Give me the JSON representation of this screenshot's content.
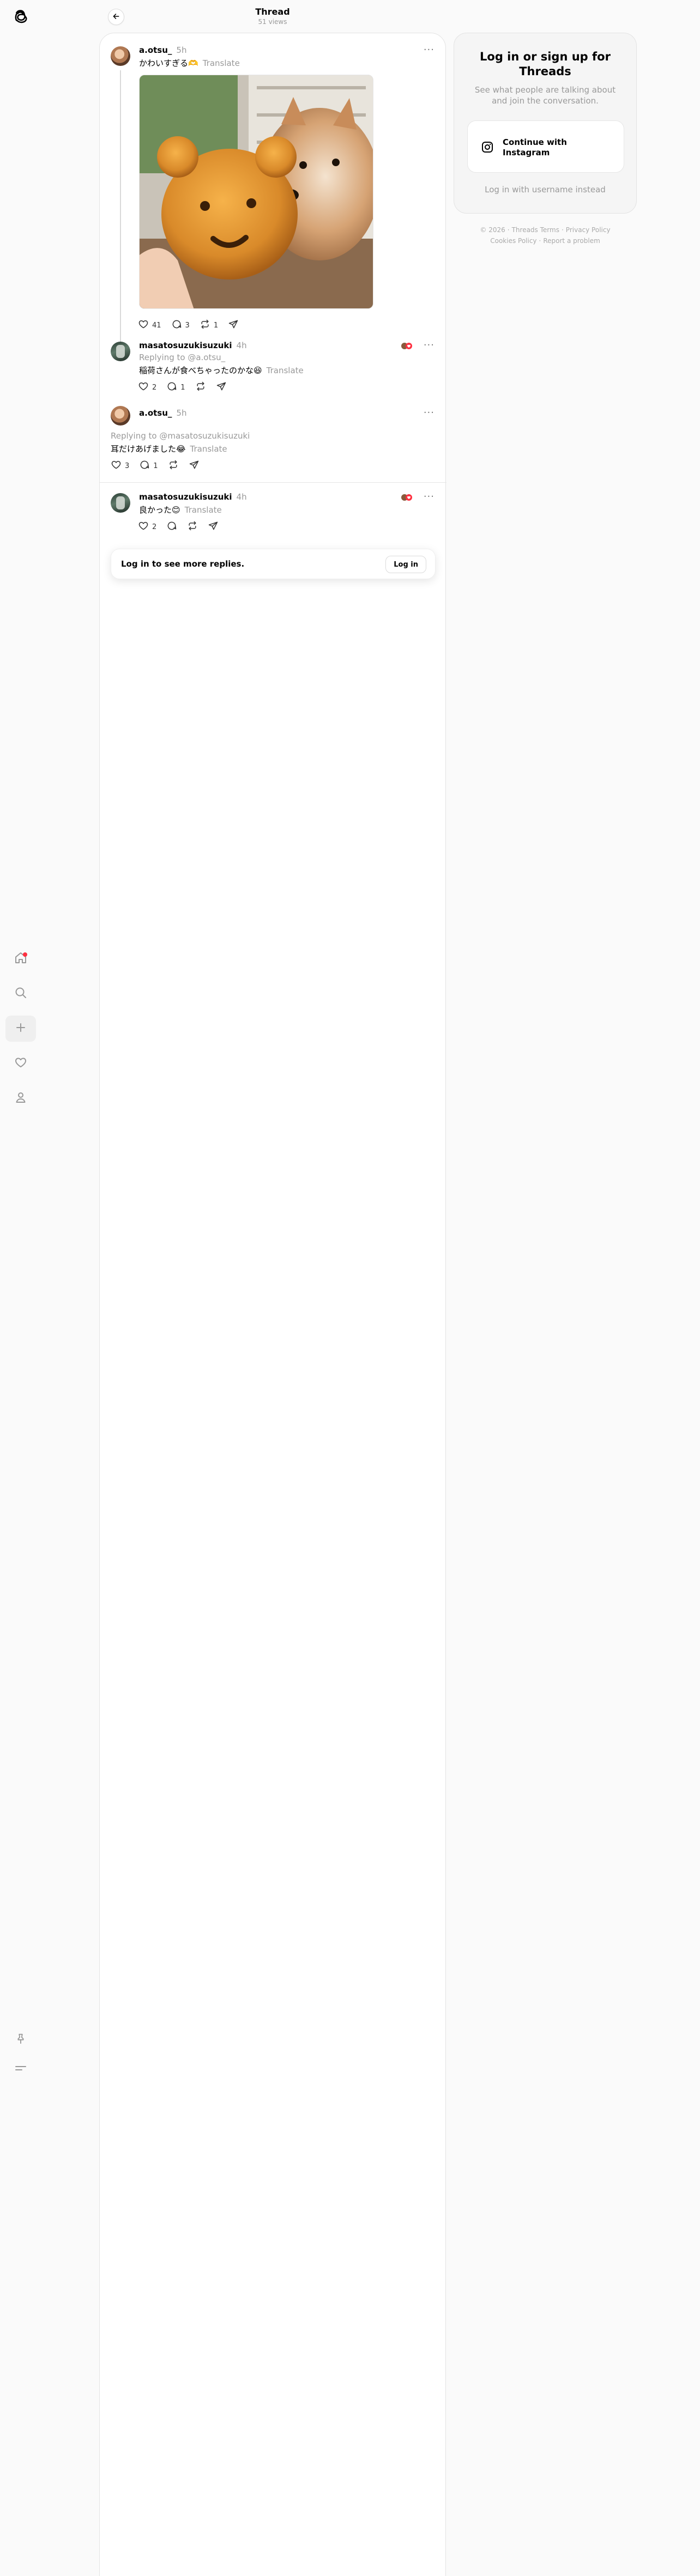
{
  "header": {
    "title": "Thread",
    "views": "51 views"
  },
  "posts": [
    {
      "username": "a.otsu_",
      "time": "5h",
      "text": "かわいすぎる🫶",
      "translate": "Translate",
      "image_alt": "bear-shaped bread held up next to a shiba inu dog",
      "likes": "41",
      "replies": "3",
      "reposts": "1"
    },
    {
      "username": "masatosuzukisuzuki",
      "time": "4h",
      "reply_to": "Replying to @a.otsu_",
      "text": "稲荷さんが食べちゃったのかな😆",
      "translate": "Translate",
      "likes": "2",
      "replies": "1"
    },
    {
      "username": "a.otsu_",
      "time": "5h",
      "reply_to": "Replying to @masatosuzukisuzuki",
      "text": "耳だけあげました😂",
      "translate": "Translate",
      "likes": "3",
      "replies": "1"
    },
    {
      "username": "masatosuzukisuzuki",
      "time": "4h",
      "text": "良かった😊",
      "translate": "Translate",
      "likes": "2"
    }
  ],
  "more_replies": {
    "text": "Log in to see more replies.",
    "button": "Log in"
  },
  "side_panel": {
    "title": "Log in or sign up for Threads",
    "description": "See what people are talking about and join the conversation.",
    "instagram_button": "Continue with Instagram",
    "alt_login": "Log in with username instead"
  },
  "footer": [
    "© 2026",
    "Threads Terms",
    "Privacy Policy",
    "Cookies Policy",
    "Report a problem"
  ],
  "nav": [
    "home-icon",
    "search-icon",
    "create-icon",
    "activity-icon",
    "profile-icon",
    "pin-icon",
    "menu-icon"
  ],
  "colors": {
    "notification_dot": "#ff3040",
    "muted_text": "#999999",
    "background": "#fafafa"
  }
}
